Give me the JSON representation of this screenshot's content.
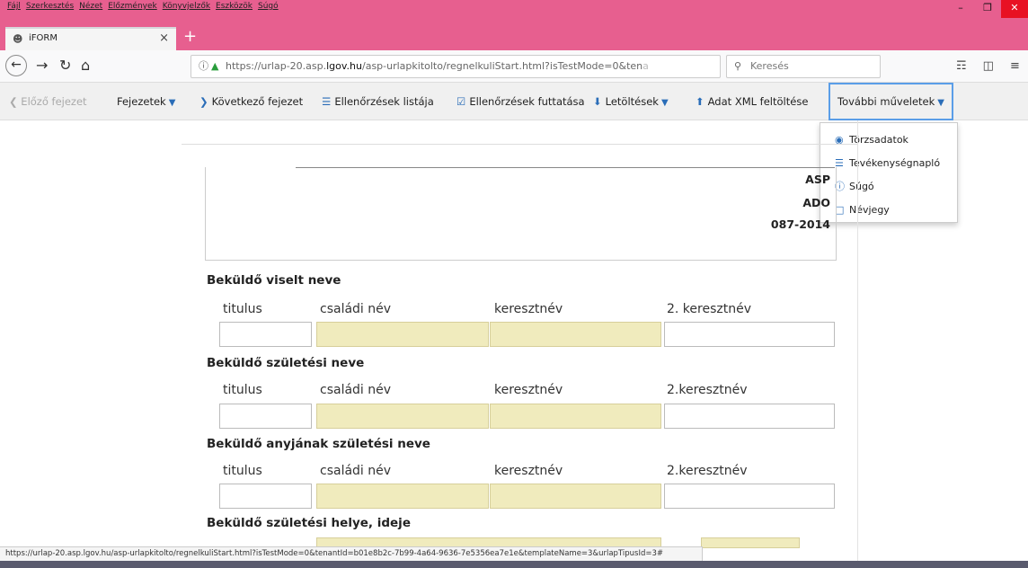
{
  "menu": [
    "Fájl",
    "Szerkesztés",
    "Nézet",
    "Előzmények",
    "Könyvjelzők",
    "Eszközök",
    "Súgó"
  ],
  "tab": {
    "title": "iFORM",
    "close": "×",
    "new": "+"
  },
  "window": {
    "minimize": "–",
    "restore": "❐",
    "close": "✕"
  },
  "url": {
    "prefix": "https://urlap-20.asp.",
    "domain": "lgov.hu",
    "path": "/asp-urlapkitolto/regnelkuliStart.html?isTestMode=0&ten",
    "fade": "a"
  },
  "search_placeholder": "Keresés",
  "toolbar": {
    "prev": "Előző fejezet",
    "chapters": "Fejezetek",
    "next": "Következő fejezet",
    "checks_list": "Ellenőrzések listája",
    "run_checks": "Ellenőrzések futtatása",
    "downloads": "Letöltések",
    "upload_xml": "Adat XML feltöltése",
    "more": "További műveletek"
  },
  "dropdown": [
    "Törzsadatok",
    "Tevékenységnapló",
    "Súgó",
    "Névjegy"
  ],
  "form_code": [
    "ASP",
    "ADO",
    "087-2014"
  ],
  "sections": [
    {
      "title": "Beküldő viselt neve",
      "labels": [
        "titulus",
        "családi név",
        "keresztnév",
        "2. keresztnév"
      ]
    },
    {
      "title": "Beküldő születési neve",
      "labels": [
        "titulus",
        "családi név",
        "keresztnév",
        "2.keresztnév"
      ]
    },
    {
      "title": "Beküldő anyjának születési neve",
      "labels": [
        "titulus",
        "családi név",
        "keresztnév",
        "2.keresztnév"
      ]
    },
    {
      "title": "Beküldő születési helye, ideje",
      "labels": []
    }
  ],
  "status_url": "https://urlap-20.asp.lgov.hu/asp-urlapkitolto/regnelkuliStart.html?isTestMode=0&tenantId=b01e8b2c-7b99-4a64-9636-7e5356ea7e1e&templateName=3&urlapTipusId=3#"
}
